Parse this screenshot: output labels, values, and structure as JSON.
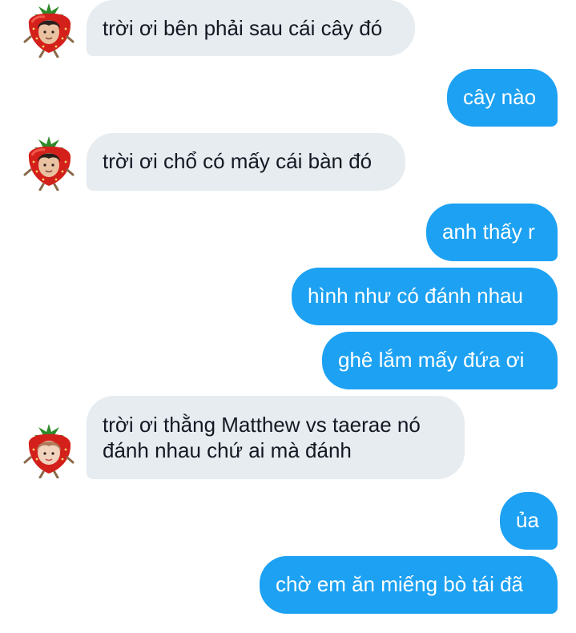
{
  "conversation": {
    "messages": [
      {
        "sender": "other",
        "text": "trời ơi bên phải sau cái cây đó"
      },
      {
        "sender": "me",
        "text": "cây nào"
      },
      {
        "sender": "other",
        "text": "trời ơi chổ có mấy cái bàn đó"
      },
      {
        "sender": "me",
        "text": "anh thấy r"
      },
      {
        "sender": "me",
        "text": "hình như có đánh nhau"
      },
      {
        "sender": "me",
        "text": "ghê lắm mấy đứa ơi"
      },
      {
        "sender": "other",
        "lines": [
          "trời ơi thằng Matthew vs taerae nó",
          "đánh nhau chứ ai mà đánh"
        ]
      },
      {
        "sender": "me",
        "text": "ủa"
      },
      {
        "sender": "me",
        "text": "chờ em ăn miếng bò tái đã"
      }
    ]
  },
  "colors": {
    "incoming_bubble": "#e6ecf0",
    "outgoing_bubble": "#1da1f2",
    "incoming_text": "#141823",
    "outgoing_text": "#ffffff"
  },
  "icons": {
    "avatar": "strawberry-avatar-icon"
  }
}
